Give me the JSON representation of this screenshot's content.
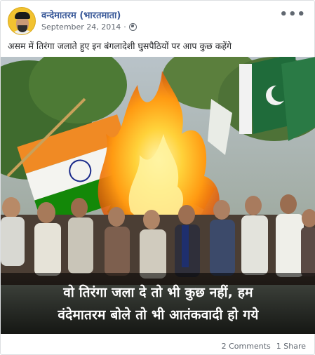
{
  "post": {
    "author": "वन्देमातरम (भारतमाता)",
    "date": "September 24, 2014",
    "separator": "·",
    "privacy_icon": "globe-icon",
    "more_icon": "more-options-icon",
    "more_glyph": "•••",
    "caption": "असम में तिरंगा जलाते हुए इन बंगलादेशी घुसपैठियों पर आप कुछ कहेंगे"
  },
  "photo": {
    "overlay_line1": "वो तिरंगा जला दे तो भी कुछ नहीं, हम",
    "overlay_line2": "वंदेमातरम बोले तो भी आतंकवादी हो गये"
  },
  "stats": {
    "comments": "2 Comments",
    "shares": "1 Share"
  },
  "colors": {
    "link": "#385898",
    "muted": "#606770",
    "saffron": "#f08a24",
    "flag_green": "#138808",
    "pak_green": "#1f6b3a",
    "fire": "#ffb21a"
  }
}
